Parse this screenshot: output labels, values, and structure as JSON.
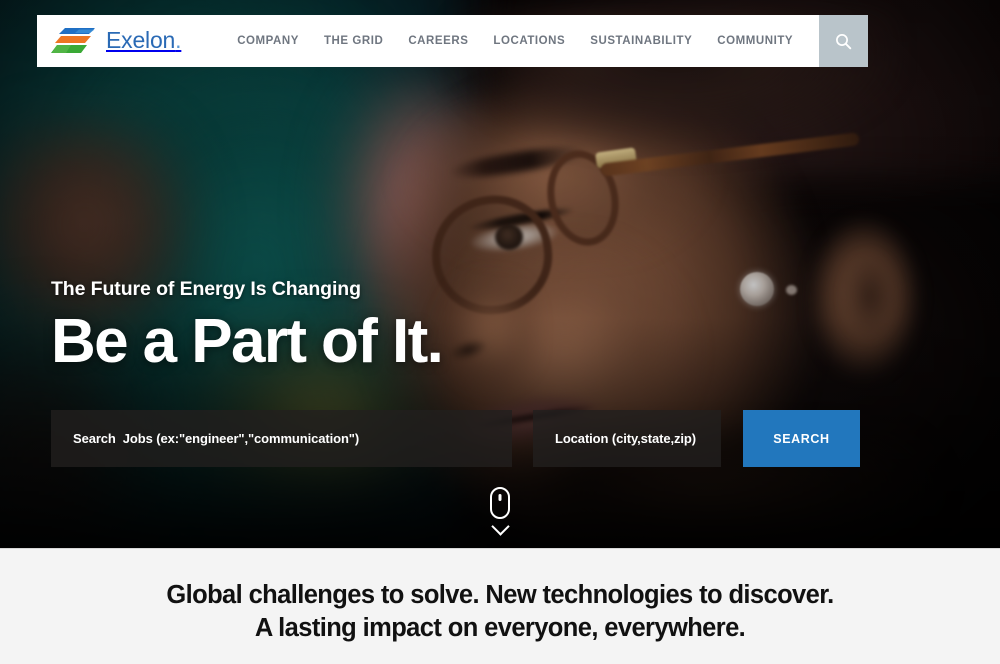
{
  "brand": {
    "name": "Exelon",
    "dot": ".",
    "logo_icon": "exelon-swoosh-logo",
    "colors": {
      "wordmark": "#2a6ab5",
      "swoosh_blue": "#1f6fc4",
      "swoosh_orange": "#ee7623",
      "swoosh_green": "#3aa935"
    }
  },
  "nav": {
    "items": [
      {
        "label": "COMPANY",
        "name": "nav-link-company"
      },
      {
        "label": "THE GRID",
        "name": "nav-link-the-grid"
      },
      {
        "label": "CAREERS",
        "name": "nav-link-careers"
      },
      {
        "label": "LOCATIONS",
        "name": "nav-link-locations"
      },
      {
        "label": "SUSTAINABILITY",
        "name": "nav-link-sustainability"
      },
      {
        "label": "COMMUNITY",
        "name": "nav-link-community"
      }
    ],
    "search_icon": "search-icon",
    "search_button_bg": "#b9c4ca"
  },
  "hero": {
    "kicker": "The Future of Energy Is Changing",
    "headline": "Be a Part of It.",
    "background_image_alt": "Close-up portrait of a woman wearing tortoiseshell eyeglasses"
  },
  "job_search": {
    "keywords_placeholder": "Search  Jobs (ex:\"engineer\",\"communication\")",
    "keywords_value": "",
    "location_placeholder": "Location (city,state,zip)",
    "location_value": "",
    "submit_label": "SEARCH",
    "submit_color": "#2277bd"
  },
  "scroll_cue": {
    "mouse_icon": "mouse-icon",
    "chevron_icon": "chevron-down-icon"
  },
  "intro": {
    "line1": "Global challenges to solve. New technologies to discover.",
    "line2": "A lasting impact on everyone, everywhere.",
    "background": "#f4f4f4"
  }
}
